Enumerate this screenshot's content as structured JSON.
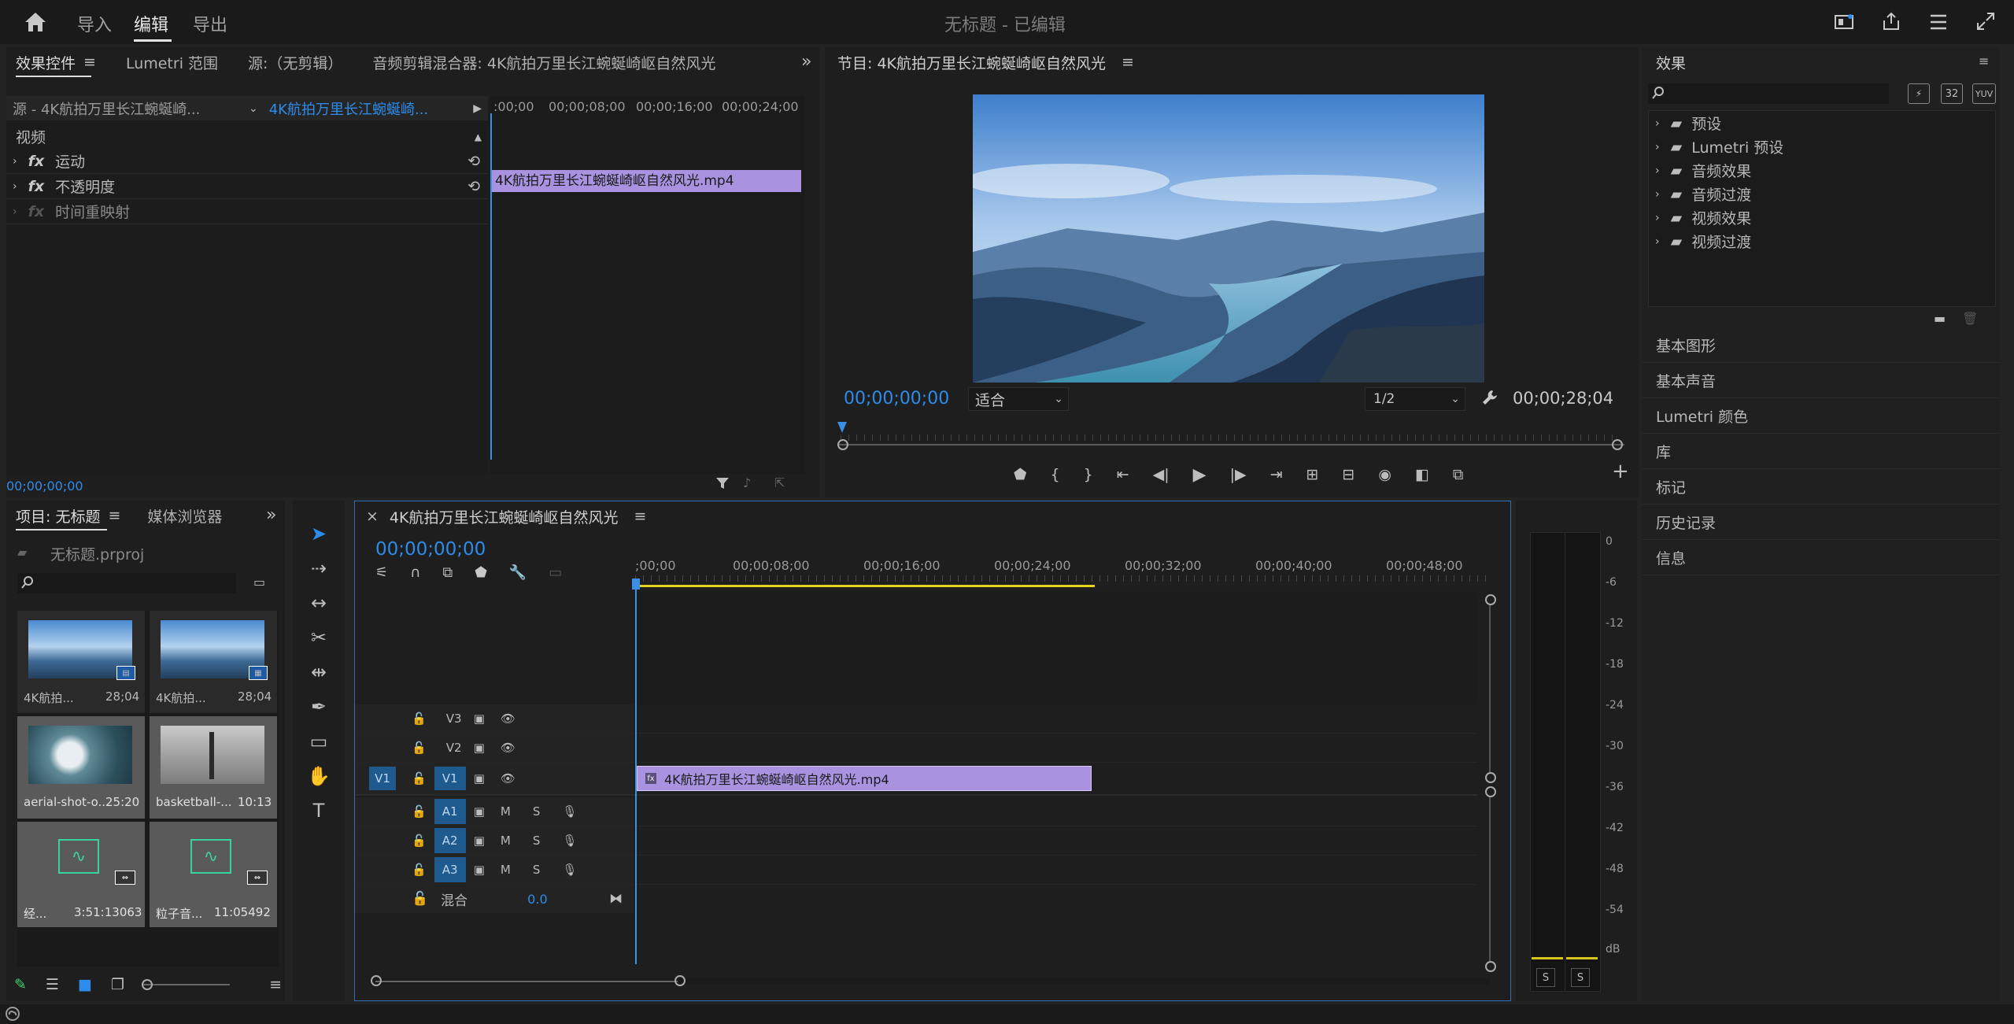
{
  "topbar": {
    "nav": [
      "导入",
      "编辑",
      "导出"
    ],
    "title": "无标题 - 已编辑"
  },
  "effect_panel": {
    "tabs": [
      "效果控件",
      "Lumetri 范围",
      "源:（无剪辑）",
      "音频剪辑混合器: 4K航拍万里长江蜿蜒崎岖自然风光"
    ],
    "source_label": "源 - 4K航拍万里长江蜿蜒崎...",
    "seq_label": "4K航拍万里长江蜿蜒崎...",
    "ruler": [
      ":00;00",
      "00;00;08;00",
      "00;00;16;00",
      "00;00;24;00"
    ],
    "clip": "4K航拍万里长江蜿蜒崎岖自然风光.mp4",
    "section": "视频",
    "items": [
      "运动",
      "不透明度",
      "时间重映射"
    ],
    "fx": "fx",
    "timecode": "00;00;00;00"
  },
  "program": {
    "title": "节目: 4K航拍万里长江蜿蜒崎岖自然风光",
    "timecode": "00;00;00;00",
    "fit": "适合",
    "resolution": "1/2",
    "duration": "00;00;28;04"
  },
  "effects": {
    "title": "效果",
    "folders": [
      "预设",
      "Lumetri 预设",
      "音频效果",
      "音频过渡",
      "视频效果",
      "视频过渡"
    ],
    "badges": [
      "32",
      "YUV"
    ],
    "sections": [
      "基本图形",
      "基本声音",
      "Lumetri 颜色",
      "库",
      "标记",
      "历史记录",
      "信息"
    ]
  },
  "project": {
    "tabs": [
      "项目: 无标题",
      "媒体浏览器"
    ],
    "file": "无标题.prproj",
    "items": [
      {
        "name": "4K航拍...",
        "dur": "28;04"
      },
      {
        "name": "4K航拍...",
        "dur": "28;04"
      },
      {
        "name": "aerial-shot-o...",
        "dur": "25:20"
      },
      {
        "name": "basketball-...",
        "dur": "10:13"
      },
      {
        "name": "经...",
        "dur": "3:51:13063"
      },
      {
        "name": "粒子音...",
        "dur": "11:05492"
      }
    ]
  },
  "timeline": {
    "title": "4K航拍万里长江蜿蜒崎岖自然风光",
    "close": "×",
    "timecode": "00;00;00;00",
    "ruler": [
      ";00;00",
      "00;00;08;00",
      "00;00;16;00",
      "00;00;24;00",
      "00;00;32;00",
      "00;00;40;00",
      "00;00;48;00"
    ],
    "video_tracks": [
      "V3",
      "V2",
      "V1"
    ],
    "audio_tracks": [
      "A1",
      "A2",
      "A3"
    ],
    "source_patch": "V1",
    "m": "M",
    "s": "S",
    "mix_label": "混合",
    "mix_value": "0.0",
    "clip": "4K航拍万里长江蜿蜒崎岖自然风光.mp4"
  },
  "meter": {
    "scale": [
      "0",
      "-6",
      "-12",
      "-18",
      "-24",
      "-30",
      "-36",
      "-42",
      "-48",
      "-54",
      "dB"
    ],
    "solo": [
      "S",
      "S"
    ]
  },
  "colors": {
    "accent": "#2d8ceb",
    "clip": "#a993e0",
    "playhead": "#3a8fe6"
  }
}
